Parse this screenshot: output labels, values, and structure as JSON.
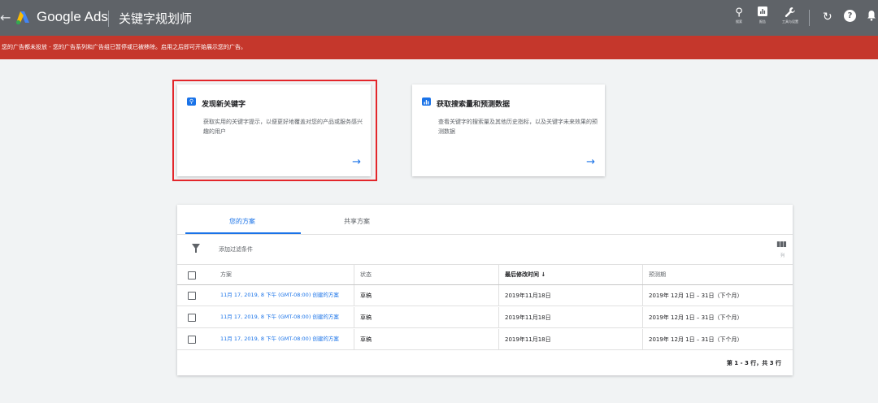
{
  "topbar": {
    "brand": "Google Ads",
    "page_title": "关键字规划师",
    "tools": [
      {
        "icon": "search-icon",
        "label": "搜索"
      },
      {
        "icon": "reports-icon",
        "label": "报告"
      },
      {
        "icon": "wrench-icon",
        "label": "工具与设置"
      }
    ]
  },
  "alert": {
    "text": "您的广告都未投放 - 您的广告系列和广告组已暂停或已被移除。启用之后即可开始展示您的广告。"
  },
  "cards": [
    {
      "title": "发现新关键字",
      "description": "获取实用的关键字提示，以便更好地覆盖对您的产品或服务感兴趣的用户"
    },
    {
      "title": "获取搜索量和预测数据",
      "description": "查看关键字的搜索量及其他历史指标，以及关键字未来效果的预测数据"
    }
  ],
  "plans": {
    "tabs": [
      {
        "label": "您的方案"
      },
      {
        "label": "共享方案"
      }
    ],
    "filter_label": "添加过滤条件",
    "columns_sublabel": "列",
    "headers": {
      "plan": "方案",
      "status": "状态",
      "modified": "最后修改时间 ↓",
      "forecast": "预测期"
    },
    "rows": [
      {
        "plan": "11月 17, 2019, 8 下午 (GMT-08:00) 创建的方案",
        "status": "草稿",
        "modified": "2019年11月18日",
        "forecast": "2019年 12月 1日 – 31日（下个月）"
      },
      {
        "plan": "11月 17, 2019, 8 下午 (GMT-08:00) 创建的方案",
        "status": "草稿",
        "modified": "2019年11月18日",
        "forecast": "2019年 12月 1日 – 31日（下个月）"
      },
      {
        "plan": "11月 17, 2019, 8 下午 (GMT-08:00) 创建的方案",
        "status": "草稿",
        "modified": "2019年11月18日",
        "forecast": "2019年 12月 1日 – 31日（下个月）"
      }
    ],
    "pagination": "第 1 - 3 行，共 3 行"
  },
  "colors": {
    "topbar": "#5f6368",
    "alert": "#c5372c",
    "accent": "#1a73e8",
    "highlight_border": "#e3262b"
  }
}
